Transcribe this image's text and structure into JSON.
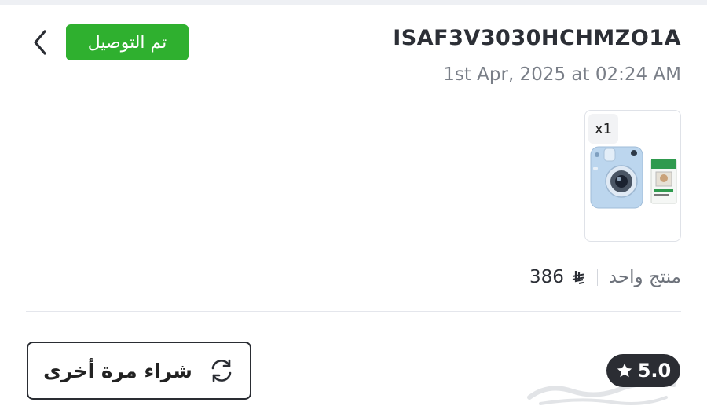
{
  "header": {
    "status_badge": "تم التوصيل",
    "order_id": "ISAF3V3030HCHMZO1A",
    "order_date": "1st Apr, 2025 at 02:24 AM",
    "back_icon": "chevron-left-icon"
  },
  "product": {
    "quantity": "x1",
    "image": "instant-camera-product-image"
  },
  "summary": {
    "item_count": "منتج واحد",
    "price": "386",
    "currency_icon": "riyal-currency-icon"
  },
  "actions": {
    "buy_again_label": "شراء مرة أخرى",
    "buy_again_icon": "refresh-icon"
  },
  "rating": {
    "value": "5.0",
    "icon": "star-icon"
  },
  "colors": {
    "status_green": "#2fb02f",
    "dark": "#2b2d33",
    "muted_text": "#7a7f88"
  }
}
